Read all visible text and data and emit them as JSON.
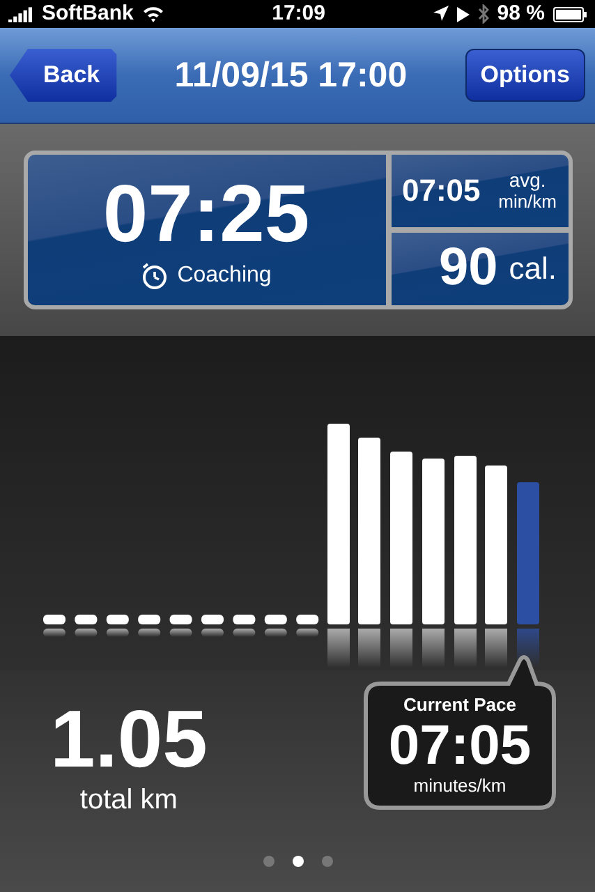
{
  "status_bar": {
    "carrier": "SoftBank",
    "time": "17:09",
    "battery": "98 %"
  },
  "nav_bar": {
    "back": "Back",
    "title": "11/09/15 17:00",
    "options": "Options"
  },
  "stats": {
    "duration": "07:25",
    "mode": "Coaching",
    "avg_pace": "07:05",
    "avg_label_1": "avg.",
    "avg_label_2": "min/km",
    "calories": "90",
    "calories_unit": "cal."
  },
  "distance": {
    "value": "1.05",
    "unit": "total km"
  },
  "current_pace": {
    "title": "Current Pace",
    "value": "07:05",
    "unit": "minutes/km"
  },
  "pages": [
    {
      "selected": false
    },
    {
      "selected": true
    },
    {
      "selected": false
    }
  ]
}
